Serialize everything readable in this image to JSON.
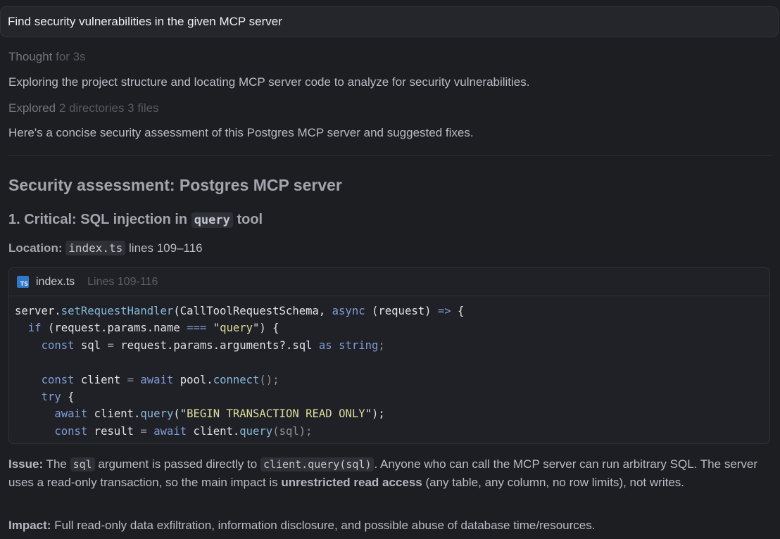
{
  "prompt": {
    "text": "Find security vulnerabilities in the given MCP server"
  },
  "thought": {
    "label": "Thought",
    "duration": "for 3s"
  },
  "exploring_text": "Exploring the project structure and locating MCP server code to analyze for security vulnerabilities.",
  "explored": {
    "label": "Explored",
    "summary": "2 directories 3 files"
  },
  "intro_text": "Here's a concise security assessment of this Postgres MCP server and suggested fixes.",
  "assessment": {
    "title": "Security assessment: Postgres MCP server",
    "finding_title_prefix": "1. Critical: SQL injection in",
    "finding_title_code": "query",
    "finding_title_suffix": "tool",
    "location_label": "Location:",
    "location_file": "index.ts",
    "location_lines": "lines 109–116"
  },
  "code_block": {
    "file_icon": "typescript-file-icon",
    "file_icon_text": "TS",
    "filename": "index.ts",
    "lines_label": "Lines 109-116",
    "language_color": "#3178c6",
    "code_lines": [
      [
        [
          "server.",
          "p"
        ],
        [
          "setRequestHandler",
          "fn"
        ],
        [
          "(CallToolRequestSchema, ",
          "p"
        ],
        [
          "async",
          "kw"
        ],
        [
          " (request) ",
          "p"
        ],
        [
          "=>",
          "kw"
        ],
        [
          " {",
          "p"
        ]
      ],
      [
        [
          "  ",
          "p"
        ],
        [
          "if",
          "kw"
        ],
        [
          " (request.params.name ",
          "p"
        ],
        [
          "===",
          "kw"
        ],
        [
          " \"",
          "p"
        ],
        [
          "query",
          "str"
        ],
        [
          "\") {",
          "p"
        ]
      ],
      [
        [
          "    ",
          "p"
        ],
        [
          "const",
          "kw"
        ],
        [
          " sql ",
          "p"
        ],
        [
          "=",
          "pn"
        ],
        [
          " request.params.arguments?.sql ",
          "p"
        ],
        [
          "as",
          "kw"
        ],
        [
          " ",
          "p"
        ],
        [
          "string",
          "kw"
        ],
        [
          ";",
          "pn"
        ]
      ],
      [
        [
          "",
          "p"
        ]
      ],
      [
        [
          "    ",
          "p"
        ],
        [
          "const",
          "kw"
        ],
        [
          " client ",
          "p"
        ],
        [
          "=",
          "pn"
        ],
        [
          " ",
          "p"
        ],
        [
          "await",
          "kw"
        ],
        [
          " pool.",
          "p"
        ],
        [
          "connect",
          "fn"
        ],
        [
          "();",
          "pn"
        ]
      ],
      [
        [
          "    ",
          "p"
        ],
        [
          "try",
          "kw"
        ],
        [
          " {",
          "p"
        ]
      ],
      [
        [
          "      ",
          "p"
        ],
        [
          "await",
          "kw"
        ],
        [
          " client.",
          "p"
        ],
        [
          "query",
          "fn"
        ],
        [
          "(\"",
          "p"
        ],
        [
          "BEGIN TRANSACTION READ ONLY",
          "str"
        ],
        [
          "\");",
          "p"
        ]
      ],
      [
        [
          "      ",
          "p"
        ],
        [
          "const",
          "kw"
        ],
        [
          " result ",
          "p"
        ],
        [
          "=",
          "pn"
        ],
        [
          " ",
          "p"
        ],
        [
          "await",
          "kw"
        ],
        [
          " client.",
          "p"
        ],
        [
          "query",
          "fn"
        ],
        [
          "(sql);",
          "pn"
        ]
      ]
    ]
  },
  "issue": {
    "label": "Issue:",
    "text_1": " The ",
    "code_1": "sql",
    "text_2": " argument is passed directly to ",
    "code_2": "client.query(sql)",
    "text_3": ". Anyone who can call the MCP server can run arbitrary SQL. The server uses a read-only transaction, so the main impact is ",
    "bold": "unrestricted read access",
    "text_4": " (any table, any column, no row limits), not writes."
  },
  "impact": {
    "label": "Impact:",
    "text": " Full read-only data exfiltration, information disclosure, and possible abuse of database time/resources."
  }
}
